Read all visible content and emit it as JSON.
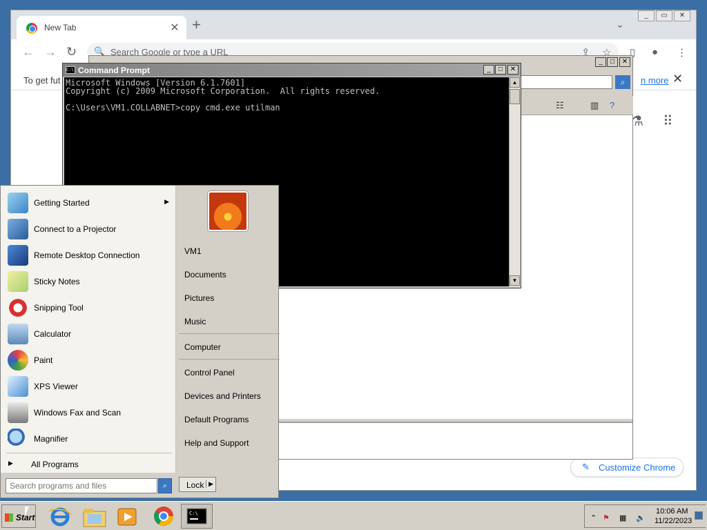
{
  "chrome": {
    "tab_title": "New Tab",
    "tab_close": "✕",
    "new_tab": "+",
    "omnibox_placeholder": "Search Google or type a URL",
    "infobar_text": "To get fut",
    "infobar_link": "n more",
    "infobar_close": "✕",
    "customize_label": "Customize Chrome"
  },
  "cmd": {
    "title": "Command Prompt",
    "lines": "Microsoft Windows [Version 6.1.7601]\nCopyright (c) 2009 Microsoft Corporation.  All rights reserved.\n\nC:\\Users\\VM1.COLLABNET>copy cmd.exe utilman"
  },
  "startmenu": {
    "programs": [
      {
        "label": "Getting Started",
        "icon": "getting-started-icon",
        "has_arrow": true
      },
      {
        "label": "Connect to a Projector",
        "icon": "projector-icon"
      },
      {
        "label": "Remote Desktop Connection",
        "icon": "remote-desktop-icon"
      },
      {
        "label": "Sticky Notes",
        "icon": "sticky-notes-icon"
      },
      {
        "label": "Snipping Tool",
        "icon": "snipping-tool-icon"
      },
      {
        "label": "Calculator",
        "icon": "calculator-icon"
      },
      {
        "label": "Paint",
        "icon": "paint-icon"
      },
      {
        "label": "XPS Viewer",
        "icon": "xps-viewer-icon"
      },
      {
        "label": "Windows Fax and Scan",
        "icon": "fax-scan-icon"
      },
      {
        "label": "Magnifier",
        "icon": "magnifier-icon"
      }
    ],
    "all_programs": "All Programs",
    "search_placeholder": "Search programs and files",
    "right_items": [
      "VM1",
      "Documents",
      "Pictures",
      "Music",
      "Computer",
      "Control Panel",
      "Devices and Printers",
      "Default Programs",
      "Help and Support"
    ],
    "lock_label": "Lock"
  },
  "taskbar": {
    "start_label": "Start",
    "time": "10:06 AM",
    "date": "11/22/2023"
  }
}
